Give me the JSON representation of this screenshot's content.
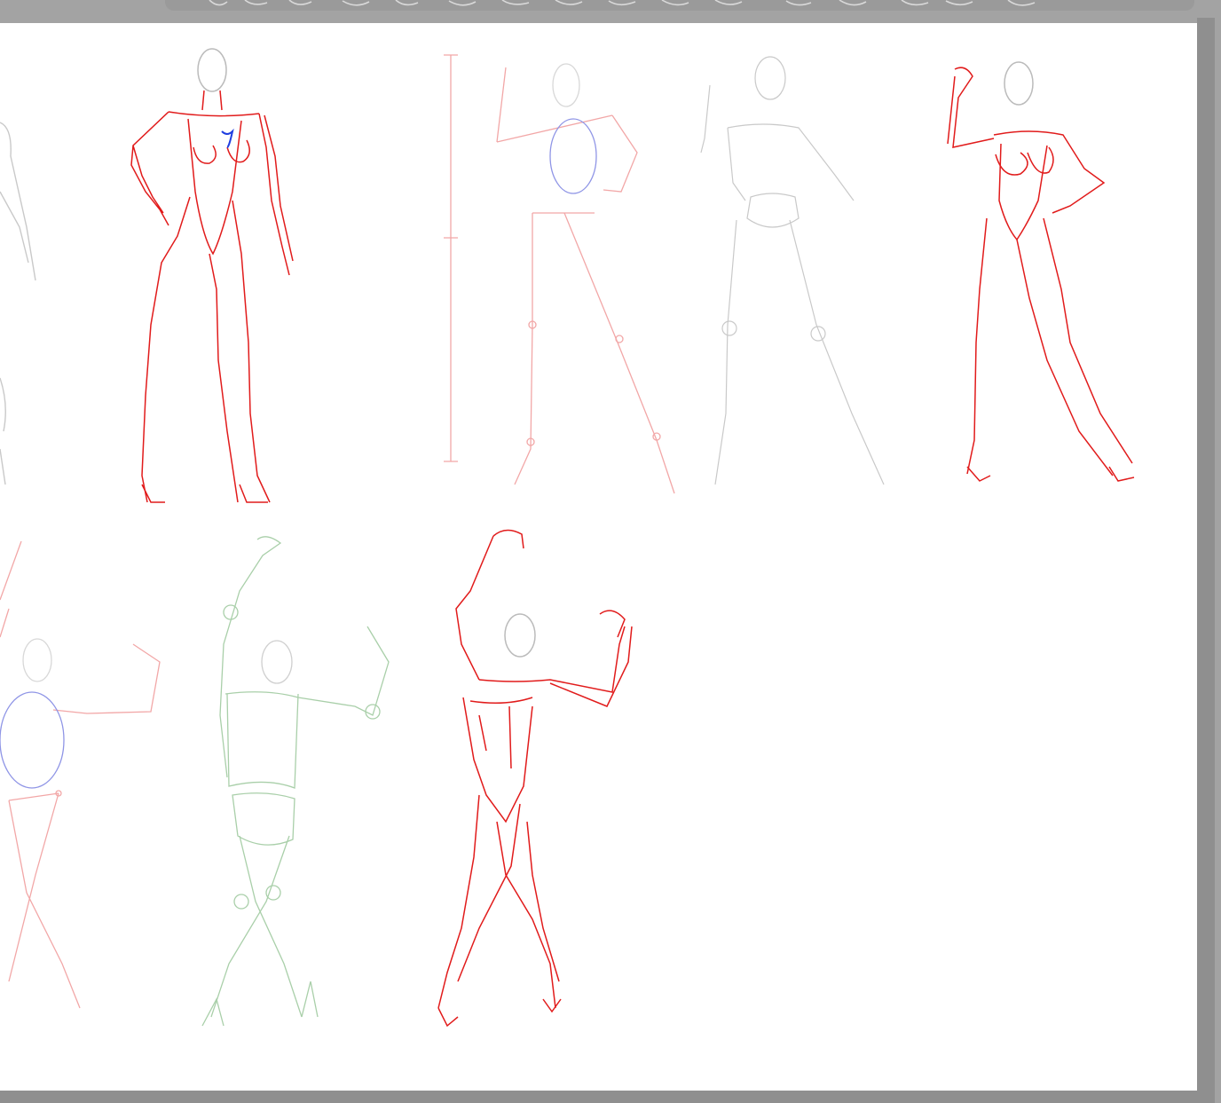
{
  "colors": {
    "frame": "#a3a3a3",
    "canvas": "#ffffff",
    "red_line": "#e11b1b",
    "light_red_line": "#f2a7a7",
    "gray_line": "#c9c9c9",
    "green_line": "#a9cfa9",
    "blue_line": "#3a4fe0",
    "light_blue_line": "#8f95e6"
  },
  "sketches": [
    {
      "name": "standing-figure-hand-on-hip",
      "style": "red lineart"
    },
    {
      "name": "proportion-guide-figure",
      "style": "light red skeleton"
    },
    {
      "name": "mannequin-figure",
      "style": "gray construction"
    },
    {
      "name": "flexing-figure",
      "style": "red lineart"
    },
    {
      "name": "arms-raised-skeleton",
      "style": "light red skeleton"
    },
    {
      "name": "arms-raised-mannequin",
      "style": "green construction"
    },
    {
      "name": "dancing-figure",
      "style": "red lineart"
    }
  ]
}
